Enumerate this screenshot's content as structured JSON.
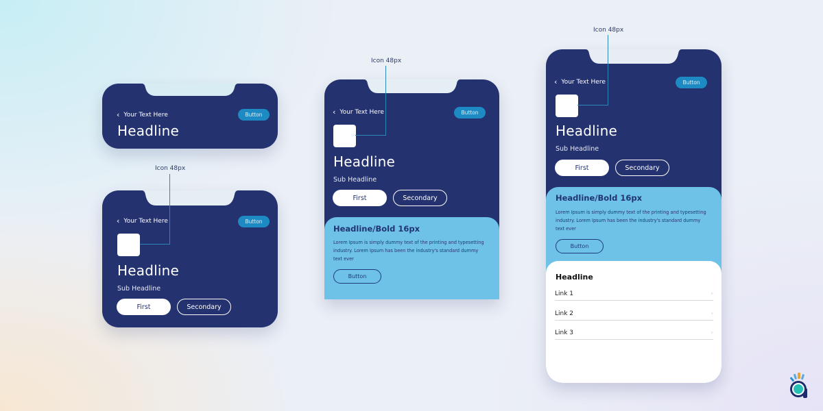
{
  "colors": {
    "navy": "#243270",
    "accent_button": "#1d8ac4",
    "light_blue_card": "#6ec2e8",
    "white": "#ffffff"
  },
  "annotations": {
    "icon_label": "Icon 48px"
  },
  "screens": [
    {
      "id": "header-compact",
      "back_label": "Your Text Here",
      "back_icon": "chevron-left-icon",
      "button_label": "Button",
      "headline": "Headline"
    },
    {
      "id": "header-with-icon",
      "annotation": "Icon 48px",
      "back_label": "Your Text Here",
      "back_icon": "chevron-left-icon",
      "button_label": "Button",
      "headline": "Headline",
      "subheadline": "Sub Headline",
      "primary_label": "First",
      "secondary_label": "Secondary"
    },
    {
      "id": "header-with-card",
      "annotation": "Icon 48px",
      "back_label": "Your Text Here",
      "back_icon": "chevron-left-icon",
      "button_label": "Button",
      "headline": "Headline",
      "subheadline": "Sub Headline",
      "primary_label": "First",
      "secondary_label": "Secondary",
      "card": {
        "title": "Headline/Bold 16px",
        "body": "Lorem Ipsum is simply dummy text of the printing and typesetting industry. Lorem Ipsum has been the industry's standard dummy text ever",
        "button_label": "Button"
      }
    },
    {
      "id": "full-screen",
      "annotation": "Icon 48px",
      "back_label": "Your Text Here",
      "back_icon": "chevron-left-icon",
      "button_label": "Button",
      "headline": "Headline",
      "subheadline": "Sub Headline",
      "primary_label": "First",
      "secondary_label": "Secondary",
      "card": {
        "title": "Headline/Bold 16px",
        "body": "Lorem Ipsum is simply dummy text of the printing and typesetting industry. Lorem Ipsum has been the industry's standard dummy text ever",
        "button_label": "Button"
      },
      "list": {
        "title": "Headline",
        "links": [
          {
            "label": "Link 1",
            "icon": "chevron-right-icon"
          },
          {
            "label": "Link 2",
            "icon": "chevron-right-icon"
          },
          {
            "label": "Link 3",
            "icon": "chevron-right-icon"
          }
        ]
      }
    }
  ],
  "brand": {
    "logo_icon": "brand-logo-icon"
  }
}
